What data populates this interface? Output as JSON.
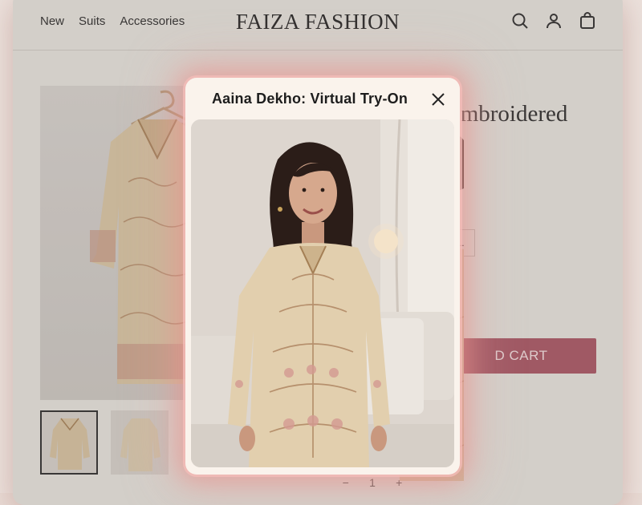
{
  "header": {
    "nav": [
      {
        "label": "New"
      },
      {
        "label": "Suits"
      },
      {
        "label": "Accessories"
      }
    ],
    "brand": "FAIZA FASHION",
    "icons": [
      "search-icon",
      "account-icon",
      "cart-icon"
    ]
  },
  "product": {
    "title_fragment": "Embroidered",
    "size_fragment": "L",
    "cart_label_fragment": "D CART",
    "quantity": {
      "minus": "−",
      "value": "1",
      "plus": "+"
    }
  },
  "modal": {
    "title": "Aaina Dekho: Virtual Try-On",
    "close_icon": "close-icon"
  },
  "colors": {
    "accent": "#a95563",
    "modal_bg": "#faf3ec",
    "glow": "#e88c87"
  }
}
